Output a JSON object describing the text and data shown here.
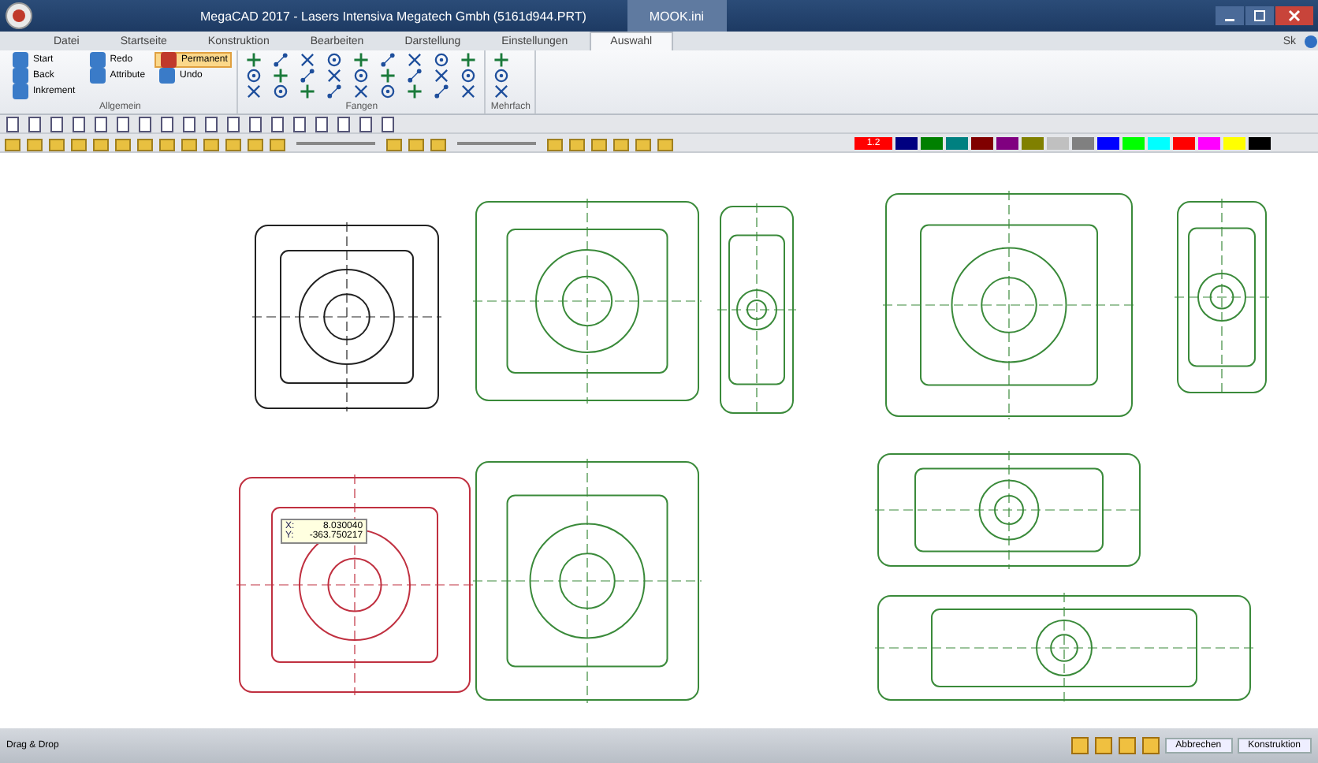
{
  "window": {
    "title": "MegaCAD 2017 - Lasers Intensiva Megatech Gmbh (5161d944.PRT)",
    "context_tab": "MOOK.ini"
  },
  "ribbon_tabs": [
    {
      "label": "Datei",
      "selected": false
    },
    {
      "label": "Startseite",
      "selected": false
    },
    {
      "label": "Konstruktion",
      "selected": false
    },
    {
      "label": "Bearbeiten",
      "selected": false
    },
    {
      "label": "Darstellung",
      "selected": false
    },
    {
      "label": "Einstellungen",
      "selected": false
    },
    {
      "label": "Auswahl",
      "selected": true
    }
  ],
  "ribbon_right": "Sk",
  "groups": [
    {
      "title": "Allgemein",
      "buttons": [
        {
          "label": "Start",
          "active": false
        },
        {
          "label": "Redo",
          "active": false
        },
        {
          "label": "Permanent",
          "active": true
        },
        {
          "label": "Back",
          "active": false
        },
        {
          "label": "Attribute",
          "active": false
        },
        {
          "label": "Undo",
          "active": false
        },
        {
          "label": "Inkrement",
          "active": false
        }
      ]
    },
    {
      "title": "Fangen",
      "kind": "snap_grid"
    },
    {
      "title": "Mehrfach",
      "kind": "multi_grid"
    }
  ],
  "palette": [
    {
      "color": "#ff0000",
      "label": "1.2"
    },
    {
      "color": "#000080"
    },
    {
      "color": "#008000"
    },
    {
      "color": "#008080"
    },
    {
      "color": "#800000"
    },
    {
      "color": "#800080"
    },
    {
      "color": "#808000"
    },
    {
      "color": "#c0c0c0"
    },
    {
      "color": "#808080"
    },
    {
      "color": "#0000ff"
    },
    {
      "color": "#00ff00"
    },
    {
      "color": "#00ffff"
    },
    {
      "color": "#ff0000"
    },
    {
      "color": "#ff00ff"
    },
    {
      "color": "#ffff00"
    },
    {
      "color": "#000000"
    }
  ],
  "coordinate_tooltip": {
    "x_label": "X:",
    "x_value": "8.030040",
    "y_label": "Y:",
    "y_value": "-363.750217"
  },
  "status_bar": {
    "message": "Drag & Drop",
    "tabs": [
      "Abbrechen",
      "Konstruktion"
    ]
  }
}
